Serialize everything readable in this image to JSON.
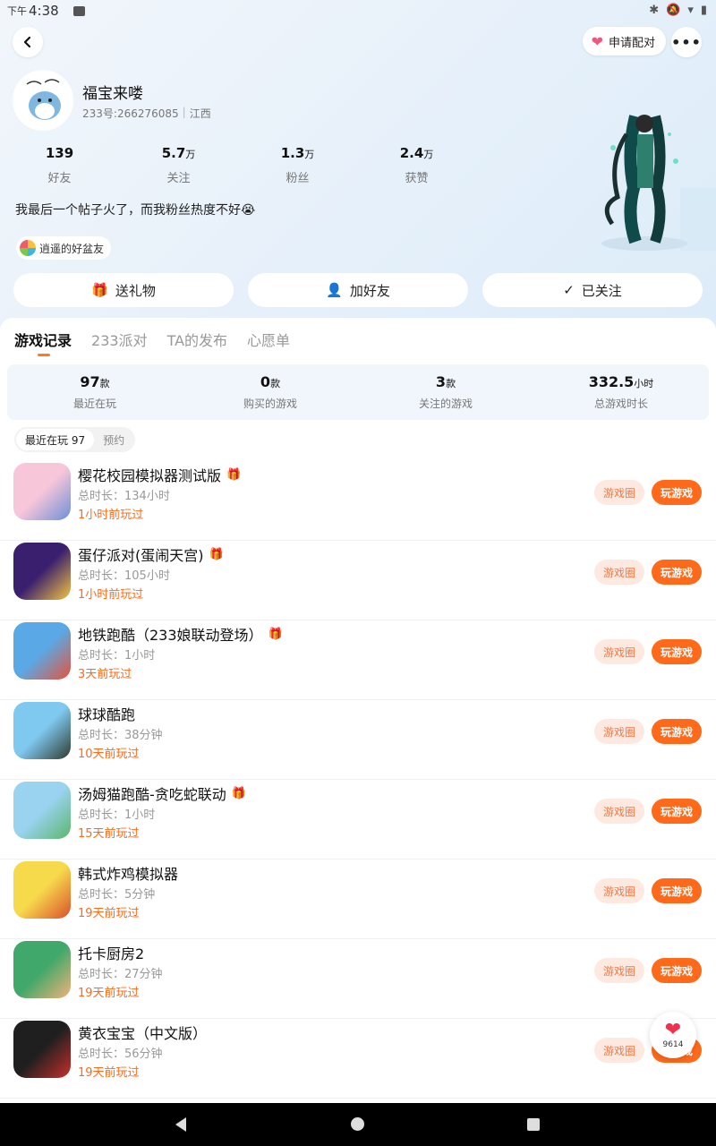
{
  "status_bar": {
    "ampm": "下午",
    "time": "4:38",
    "icons": [
      "bluetooth-icon",
      "mute-icon",
      "wifi-icon",
      "battery-icon"
    ]
  },
  "header": {
    "match_label": "申请配对",
    "more_icon": "more-icon",
    "back_icon": "back-icon"
  },
  "profile": {
    "name": "福宝来喽",
    "id_label": "233号:266276085",
    "region": "江西",
    "bio": "我最后一个帖子火了，而我粉丝热度不好😭",
    "friend_tag": "逍遥的好盆友"
  },
  "stats": [
    {
      "value": "139",
      "unit": "",
      "label": "好友"
    },
    {
      "value": "5.7",
      "unit": "万",
      "label": "关注"
    },
    {
      "value": "1.3",
      "unit": "万",
      "label": "粉丝"
    },
    {
      "value": "2.4",
      "unit": "万",
      "label": "获赞"
    }
  ],
  "actions": {
    "gift": "送礼物",
    "add_friend": "加好友",
    "followed": "已关注"
  },
  "tabs": [
    "游戏记录",
    "233派对",
    "TA的发布",
    "心愿单"
  ],
  "summary": [
    {
      "value": "97",
      "unit": "款",
      "label": "最近在玩"
    },
    {
      "value": "0",
      "unit": "款",
      "label": "购买的游戏"
    },
    {
      "value": "3",
      "unit": "款",
      "label": "关注的游戏"
    },
    {
      "value": "332.5",
      "unit": "小时",
      "label": "总游戏时长"
    }
  ],
  "filters": {
    "recent": "最近在玩 97",
    "reserve": "预约"
  },
  "game_buttons": {
    "circle": "游戏圈",
    "play": "玩游戏"
  },
  "games": [
    {
      "name": "樱花校园模拟器测试版",
      "duration": "总时长：134小时",
      "last": "1小时前玩过",
      "gift": true,
      "colors": [
        "#f7c6d9",
        "#6c8fd8"
      ]
    },
    {
      "name": "蛋仔派对(蛋闹天宫)",
      "duration": "总时长：105小时",
      "last": "1小时前玩过",
      "gift": true,
      "colors": [
        "#3a1f6e",
        "#f5c542"
      ]
    },
    {
      "name": "地铁跑酷（233娘联动登场）",
      "duration": "总时长：1小时",
      "last": "3天前玩过",
      "gift": true,
      "colors": [
        "#5aa9e6",
        "#e5533c"
      ]
    },
    {
      "name": "球球酷跑",
      "duration": "总时长：38分钟",
      "last": "10天前玩过",
      "gift": false,
      "colors": [
        "#7fc8f0",
        "#2d3b2d"
      ]
    },
    {
      "name": "汤姆猫跑酷-贪吃蛇联动",
      "duration": "总时长：1小时",
      "last": "15天前玩过",
      "gift": true,
      "colors": [
        "#9ad3f0",
        "#5bb66a"
      ]
    },
    {
      "name": "韩式炸鸡模拟器",
      "duration": "总时长：5分钟",
      "last": "19天前玩过",
      "gift": false,
      "colors": [
        "#f7d94c",
        "#d9502b"
      ]
    },
    {
      "name": "托卡厨房2",
      "duration": "总时长：27分钟",
      "last": "19天前玩过",
      "gift": false,
      "colors": [
        "#3fa86a",
        "#f2b27a"
      ]
    },
    {
      "name": "黄衣宝宝（中文版）",
      "duration": "总时长：56分钟",
      "last": "19天前玩过",
      "gift": false,
      "colors": [
        "#1f1f1f",
        "#c9302c"
      ]
    }
  ],
  "float_like": {
    "count": "9614"
  }
}
